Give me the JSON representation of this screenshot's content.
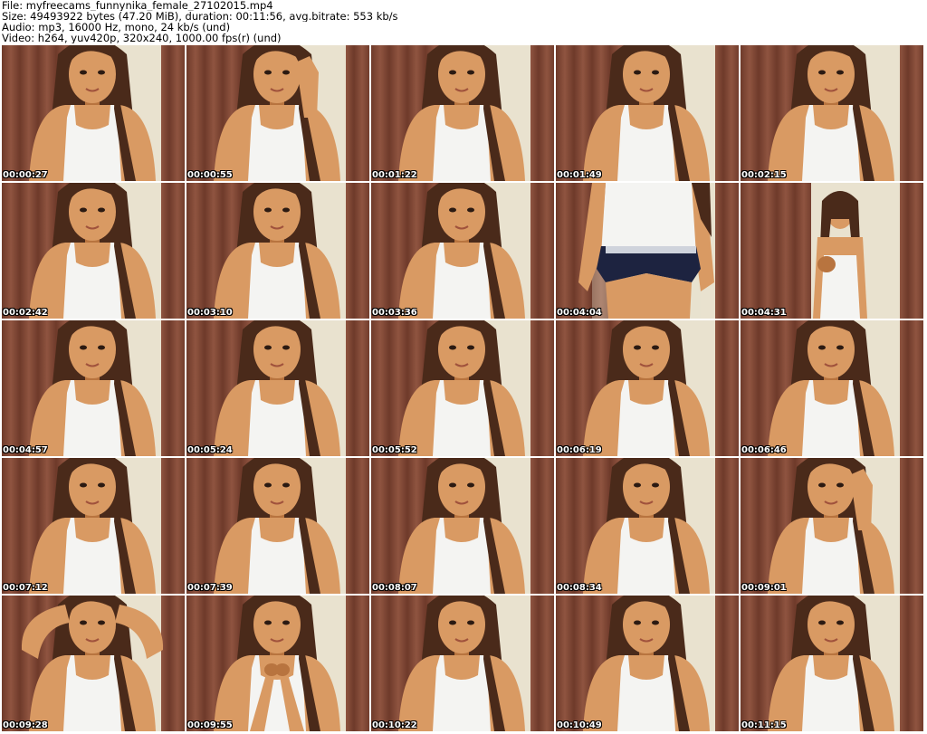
{
  "header": {
    "file_line": "File: myfreecams_funnynika_female_27102015.mp4",
    "size_line": "Size: 49493922 bytes (47.20 MiB), duration: 00:11:56, avg.bitrate: 553 kb/s",
    "audio_line": "Audio: mp3, 16000 Hz, mono, 24 kb/s (und)",
    "video_line": "Video: h264, yuv420p, 320x240, 1000.00 fps(r) (und)"
  },
  "colors": {
    "curtain_dark": "#6e3a2a",
    "curtain_mid": "#8f5440",
    "wall_light": "#e9e2cf",
    "skin": "#d99a63",
    "skin_shadow": "#b8743f",
    "hair": "#4a2a1a",
    "top_white": "#f4f4f2",
    "shorts_navy": "#1d2340"
  },
  "thumbnails": [
    {
      "time": "00:00:27",
      "pose": "sit"
    },
    {
      "time": "00:00:55",
      "pose": "hand"
    },
    {
      "time": "00:01:22",
      "pose": "sit"
    },
    {
      "time": "00:01:49",
      "pose": "sit"
    },
    {
      "time": "00:02:15",
      "pose": "sit"
    },
    {
      "time": "00:02:42",
      "pose": "sit"
    },
    {
      "time": "00:03:10",
      "pose": "sit"
    },
    {
      "time": "00:03:36",
      "pose": "sit"
    },
    {
      "time": "00:04:04",
      "pose": "standing"
    },
    {
      "time": "00:04:31",
      "pose": "far"
    },
    {
      "time": "00:04:57",
      "pose": "sit"
    },
    {
      "time": "00:05:24",
      "pose": "sit"
    },
    {
      "time": "00:05:52",
      "pose": "sit"
    },
    {
      "time": "00:06:19",
      "pose": "sit"
    },
    {
      "time": "00:06:46",
      "pose": "sit"
    },
    {
      "time": "00:07:12",
      "pose": "sit"
    },
    {
      "time": "00:07:39",
      "pose": "sit"
    },
    {
      "time": "00:08:07",
      "pose": "sit"
    },
    {
      "time": "00:08:34",
      "pose": "sit"
    },
    {
      "time": "00:09:01",
      "pose": "hand"
    },
    {
      "time": "00:09:28",
      "pose": "arms-up"
    },
    {
      "time": "00:09:55",
      "pose": "hands-front"
    },
    {
      "time": "00:10:22",
      "pose": "sit"
    },
    {
      "time": "00:10:49",
      "pose": "sit"
    },
    {
      "time": "00:11:15",
      "pose": "sit"
    }
  ]
}
